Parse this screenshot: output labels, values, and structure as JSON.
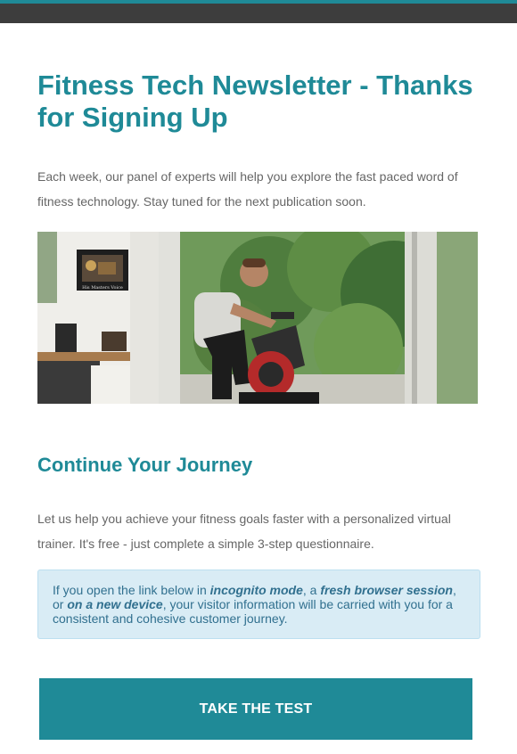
{
  "header": {
    "title": "Fitness Tech Newsletter - Thanks for Signing Up"
  },
  "intro": {
    "text": "Each week, our panel of experts will help you explore the fast paced word of fitness technology. Stay tuned for the next publication soon."
  },
  "hero": {
    "poster_caption": "His Masters Voice"
  },
  "journey": {
    "title": "Continue Your Journey",
    "text": "Let us help you achieve your fitness goals faster with a personalized virtual trainer. It's free - just complete a simple 3-step questionnaire."
  },
  "notice": {
    "part1": "If you open the link below in ",
    "em1": "incognito mode",
    "part2": ", a ",
    "em2": "fresh browser session",
    "part3": ", or ",
    "em3": "on a new device",
    "part4": ", your visitor information will be carried with you for a consistent and cohesive customer journey."
  },
  "cta": {
    "label": "TAKE THE TEST"
  },
  "colors": {
    "accent": "#1f8a97",
    "top_bar": "#3d3d3d",
    "notice_bg": "#d9ecf5",
    "notice_text": "#31708f",
    "body_text": "#666666"
  }
}
